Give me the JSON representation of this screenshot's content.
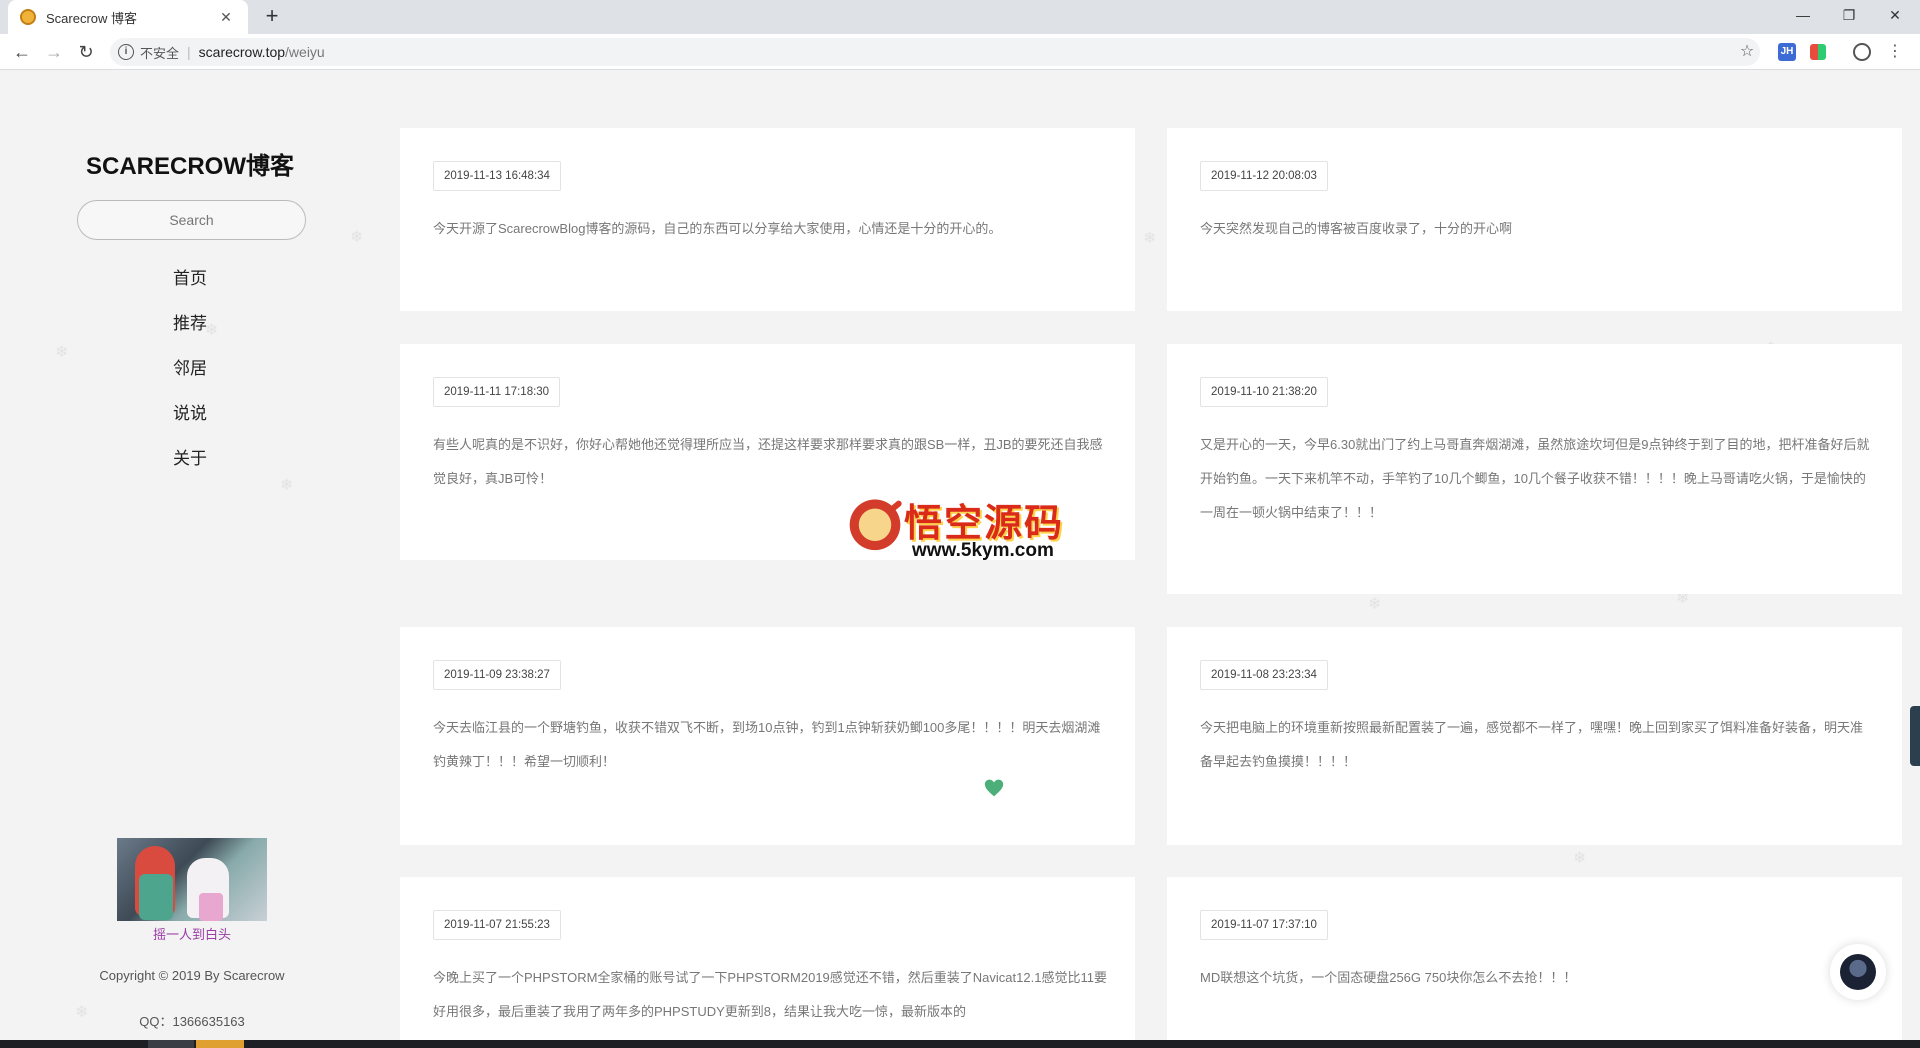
{
  "browser": {
    "tab_title": "Scarecrow 博客",
    "insecure_label": "不安全",
    "url_host": "scarecrow.top",
    "url_path": "/weiyu",
    "ext_label": "JH"
  },
  "sidebar": {
    "blog_title": "SCARECROW博客",
    "search_placeholder": "Search",
    "menu": [
      "首页",
      "推荐",
      "邻居",
      "说说",
      "关于"
    ],
    "image_caption": "摇一人到白头",
    "copyright": "Copyright © 2019 By Scarecrow",
    "qq": "QQ：1366635163"
  },
  "posts": [
    {
      "date": "2019-11-13 16:48:34",
      "text": "今天开源了ScarecrowBlog博客的源码，自己的东西可以分享给大家使用，心情还是十分的开心的。"
    },
    {
      "date": "2019-11-12 20:08:03",
      "text": "今天突然发现自己的博客被百度收录了，十分的开心啊"
    },
    {
      "date": "2019-11-11 17:18:30",
      "text": "有些人呢真的是不识好，你好心帮她他还觉得理所应当，还提这样要求那样要求真的跟SB一样，丑JB的要死还自我感觉良好，真JB可怜！"
    },
    {
      "date": "2019-11-10 21:38:20",
      "text": "又是开心的一天，今早6.30就出门了约上马哥直奔烟湖滩，虽然旅途坎坷但是9点钟终于到了目的地，把杆准备好后就开始钓鱼。一天下来机竿不动，手竿钓了10几个鲫鱼，10几个餐子收获不错！！！！晚上马哥请吃火锅，于是愉快的一周在一顿火锅中结束了！！！"
    },
    {
      "date": "2019-11-09 23:38:27",
      "text": "今天去临江县的一个野塘钓鱼，收获不错双飞不断，到场10点钟，钓到1点钟斩获奶鲫100多尾！！！！明天去烟湖滩钓黄辣丁！！！希望一切顺利！"
    },
    {
      "date": "2019-11-08 23:23:34",
      "text": "今天把电脑上的环境重新按照最新配置装了一遍，感觉都不一样了，嘿嘿！晚上回到家买了饵料准备好装备，明天准备早起去钓鱼摸摸！！！！"
    },
    {
      "date": "2019-11-07 21:55:23",
      "text": "今晚上买了一个PHPSTORM全家桶的账号试了一下PHPSTORM2019感觉还不错，然后重装了Navicat12.1感觉比11要好用很多，最后重装了我用了两年多的PHPSTUDY更新到8，结果让我大吃一惊，最新版本的"
    },
    {
      "date": "2019-11-07 17:37:10",
      "text": "MD联想这个坑货，一个固态硬盘256G 750块你怎么不去抢！！！"
    }
  ],
  "watermark": {
    "title": "悟空源码",
    "url": "www.5kym.com"
  },
  "colors": {
    "page_bg": "#f3f3f3",
    "card_bg": "#ffffff",
    "caption": "#9b3ba6",
    "heart": "#4caf7a"
  }
}
